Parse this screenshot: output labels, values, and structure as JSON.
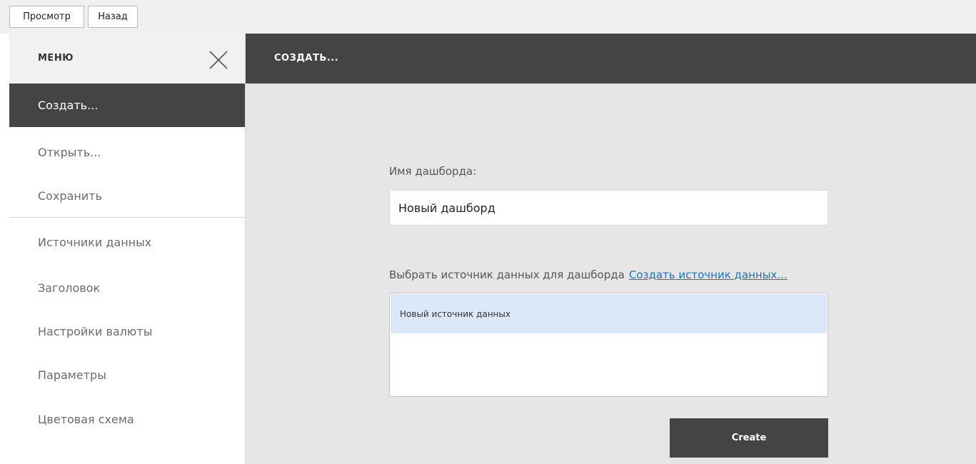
{
  "toolbar": {
    "view_label": "Просмотр",
    "back_label": "Назад"
  },
  "menu": {
    "title": "МЕНЮ",
    "close_icon": "close-icon",
    "items": [
      {
        "label": "Создать..."
      },
      {
        "label": "Открыть..."
      },
      {
        "label": "Сохранить"
      },
      {
        "label": "Источники данных"
      },
      {
        "label": "Заголовок"
      },
      {
        "label": "Настройки валюты"
      },
      {
        "label": "Параметры"
      },
      {
        "label": "Цветовая схема"
      }
    ]
  },
  "main": {
    "title": "СОЗДАТЬ...",
    "name_label": "Имя дашборда:",
    "name_value": "Новый дашборд",
    "source_label": "Выбрать источник данных для дашборда",
    "source_link": "Создать источник данных...",
    "sources": [
      {
        "label": "Новый источник данных"
      }
    ],
    "create_label": "Create"
  },
  "colors": {
    "dark": "#444444",
    "selection": "#dbe8f9",
    "link": "#1a73c8"
  }
}
